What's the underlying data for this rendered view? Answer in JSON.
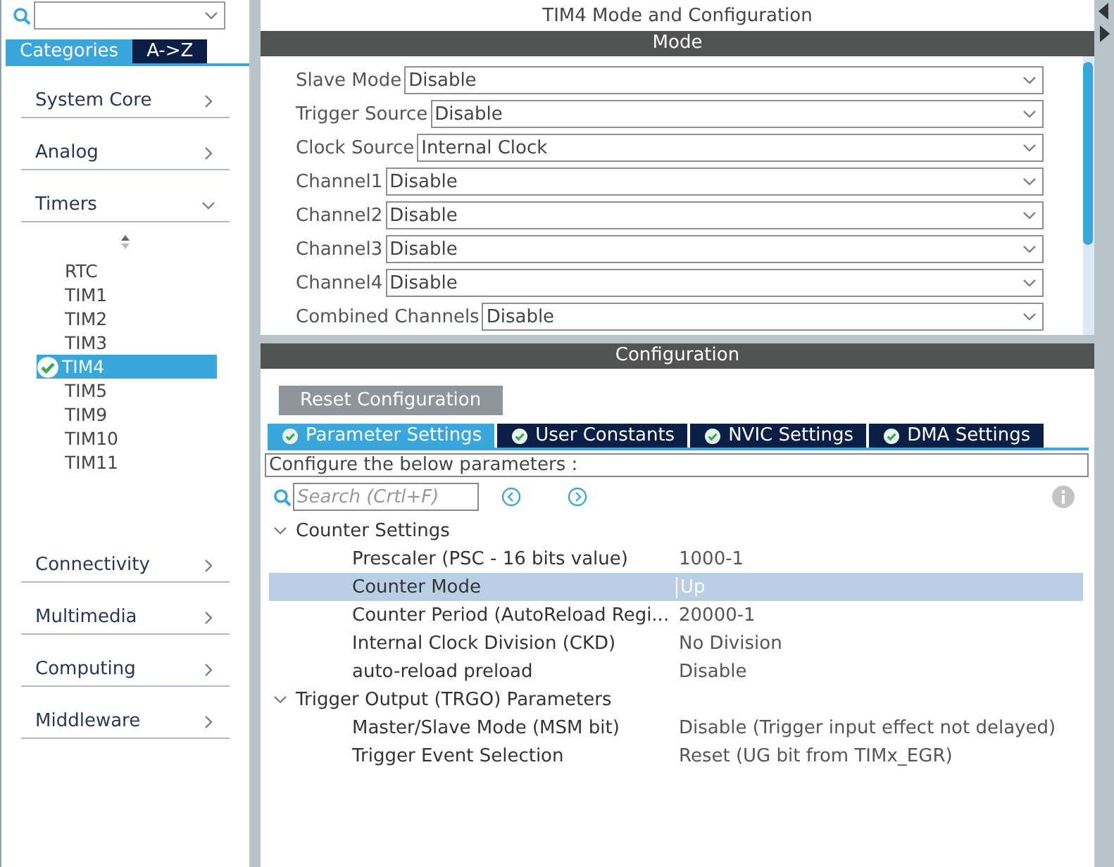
{
  "sidebar": {
    "tabs": [
      {
        "label": "Categories",
        "selected": true
      },
      {
        "label": "A->Z",
        "selected": false
      }
    ],
    "categories": [
      {
        "label": "System Core",
        "expanded": false
      },
      {
        "label": "Analog",
        "expanded": false
      },
      {
        "label": "Timers",
        "expanded": true,
        "items": [
          {
            "label": "RTC",
            "selected": false,
            "configured": false
          },
          {
            "label": "TIM1",
            "selected": false,
            "configured": false
          },
          {
            "label": "TIM2",
            "selected": false,
            "configured": false
          },
          {
            "label": "TIM3",
            "selected": false,
            "configured": false
          },
          {
            "label": "TIM4",
            "selected": true,
            "configured": true
          },
          {
            "label": "TIM5",
            "selected": false,
            "configured": false
          },
          {
            "label": "TIM9",
            "selected": false,
            "configured": false
          },
          {
            "label": "TIM10",
            "selected": false,
            "configured": false
          },
          {
            "label": "TIM11",
            "selected": false,
            "configured": false
          }
        ]
      },
      {
        "label": "Connectivity",
        "expanded": false
      },
      {
        "label": "Multimedia",
        "expanded": false
      },
      {
        "label": "Computing",
        "expanded": false
      },
      {
        "label": "Middleware",
        "expanded": false
      }
    ]
  },
  "title": "TIM4 Mode and Configuration",
  "mode": {
    "header": "Mode",
    "fields": [
      {
        "label": "Slave Mode",
        "value": "Disable"
      },
      {
        "label": "Trigger Source",
        "value": "Disable"
      },
      {
        "label": "Clock Source",
        "value": "Internal Clock"
      },
      {
        "label": "Channel1",
        "value": "Disable"
      },
      {
        "label": "Channel2",
        "value": "Disable"
      },
      {
        "label": "Channel3",
        "value": "Disable"
      },
      {
        "label": "Channel4",
        "value": "Disable"
      },
      {
        "label": "Combined Channels",
        "value": "Disable"
      }
    ]
  },
  "configuration": {
    "header": "Configuration",
    "reset_button": "Reset Configuration",
    "tabs": [
      {
        "label": "Parameter Settings",
        "selected": true
      },
      {
        "label": "User Constants",
        "selected": false
      },
      {
        "label": "NVIC Settings",
        "selected": false
      },
      {
        "label": "DMA Settings",
        "selected": false
      }
    ],
    "description": "Configure the below parameters :",
    "search": {
      "placeholder": "Search (Crtl+F)"
    },
    "groups": [
      {
        "label": "Counter Settings",
        "expanded": true,
        "children": [
          {
            "name": "Prescaler (PSC - 16 bits value)",
            "value": "1000-1",
            "selected": false
          },
          {
            "name": "Counter Mode",
            "value": "Up",
            "selected": true
          },
          {
            "name": "Counter Period (AutoReload Regi...",
            "value": "20000-1",
            "selected": false
          },
          {
            "name": "Internal Clock Division (CKD)",
            "value": "No Division",
            "selected": false
          },
          {
            "name": "auto-reload preload",
            "value": "Disable",
            "selected": false
          }
        ]
      },
      {
        "label": "Trigger Output (TRGO) Parameters",
        "expanded": true,
        "children": [
          {
            "name": "Master/Slave Mode (MSM bit)",
            "value": "Disable (Trigger input effect not delayed)",
            "selected": false
          },
          {
            "name": "Trigger Event Selection",
            "value": "Reset (UG bit from TIMx_EGR)",
            "selected": false
          }
        ]
      }
    ]
  }
}
